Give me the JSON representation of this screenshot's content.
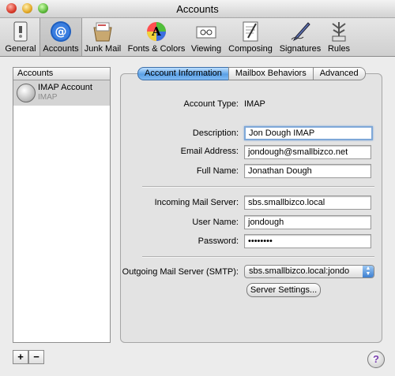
{
  "window": {
    "title": "Accounts"
  },
  "toolbar": {
    "items": [
      {
        "label": "General",
        "icon": "switch-icon"
      },
      {
        "label": "Accounts",
        "icon": "at-sign-icon"
      },
      {
        "label": "Junk Mail",
        "icon": "junk-mail-icon"
      },
      {
        "label": "Fonts & Colors",
        "icon": "fonts-colors-icon"
      },
      {
        "label": "Viewing",
        "icon": "viewing-icon"
      },
      {
        "label": "Composing",
        "icon": "composing-icon"
      },
      {
        "label": "Signatures",
        "icon": "signature-pen-icon"
      },
      {
        "label": "Rules",
        "icon": "rules-icon"
      }
    ],
    "selected": "Accounts"
  },
  "sidebar": {
    "header": "Accounts",
    "accounts": [
      {
        "name": "IMAP Account",
        "type": "IMAP"
      }
    ],
    "add_label": "+",
    "remove_label": "−"
  },
  "tabs": {
    "items": [
      "Account Information",
      "Mailbox Behaviors",
      "Advanced"
    ],
    "active": "Account Information"
  },
  "form": {
    "account_type_label": "Account Type:",
    "account_type_value": "IMAP",
    "description_label": "Description:",
    "description_value": "Jon Dough IMAP",
    "email_label": "Email Address:",
    "email_value": "jondough@smallbizco.net",
    "fullname_label": "Full Name:",
    "fullname_value": "Jonathan Dough",
    "incoming_label": "Incoming Mail Server:",
    "incoming_value": "sbs.smallbizco.local",
    "username_label": "User Name:",
    "username_value": "jondough",
    "password_label": "Password:",
    "password_value": "••••••••",
    "smtp_label": "Outgoing Mail Server (SMTP):",
    "smtp_value": "sbs.smallbizco.local:jondo",
    "server_settings_label": "Server Settings..."
  },
  "help": {
    "label": "?"
  },
  "colors": {
    "tab_active": "#5aa0e6",
    "help_glyph": "#7a3fb0"
  }
}
